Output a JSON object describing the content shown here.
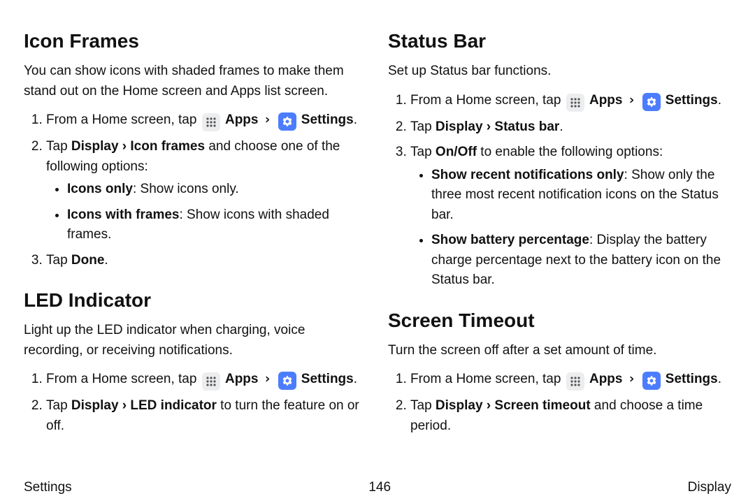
{
  "footer": {
    "left": "Settings",
    "center": "146",
    "right": "Display"
  },
  "icons": {
    "apps_label": "Apps",
    "settings_label": "Settings"
  },
  "phrase": {
    "from_home": "From a Home screen, tap",
    "chevron": "›"
  },
  "left": {
    "sec1": {
      "title": "Icon Frames",
      "lead": "You can show icons with shaded frames to make them stand out on the Home screen and Apps list screen.",
      "step2_pre": "Tap ",
      "step2_path": "Display › Icon frames",
      "step2_post": " and choose one of the following options:",
      "bullet1_b": "Icons only",
      "bullet1_rest": ": Show icons only.",
      "bullet2_b": "Icons with frames",
      "bullet2_rest": ": Show icons with shaded frames.",
      "step3_pre": "Tap ",
      "step3_b": "Done",
      "step3_post": "."
    },
    "sec2": {
      "title": "LED Indicator",
      "lead": "Light up the LED indicator when charging, voice recording, or receiving notifications.",
      "step2_pre": "Tap ",
      "step2_path": "Display › LED indicator",
      "step2_post": " to turn the feature on or off."
    }
  },
  "right": {
    "sec1": {
      "title": "Status Bar",
      "lead": "Set up Status bar functions.",
      "step2_pre": "Tap ",
      "step2_path": "Display › Status bar",
      "step2_post": ".",
      "step3_pre": "Tap ",
      "step3_b": "On/Off",
      "step3_post": " to enable the following options:",
      "bullet1_b": "Show recent notifications only",
      "bullet1_rest": ": Show only the three most recent notification icons on the Status bar.",
      "bullet2_b": "Show battery percentage",
      "bullet2_rest": ": Display the battery charge percentage next to the battery icon on the Status bar."
    },
    "sec2": {
      "title": "Screen Timeout",
      "lead": "Turn the screen off after a set amount of time.",
      "step2_pre": "Tap ",
      "step2_path": "Display › Screen timeout",
      "step2_post": " and choose a time period."
    }
  }
}
